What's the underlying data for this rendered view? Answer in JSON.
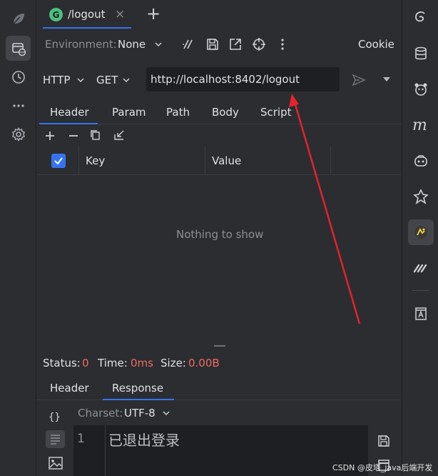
{
  "tab": {
    "badge": "G",
    "title": "/logout",
    "close": "×",
    "add": "+"
  },
  "toolbar": {
    "env_label": "Environment:",
    "env_value": "None",
    "cookie": "Cookie"
  },
  "request": {
    "protocol": "HTTP",
    "method": "GET",
    "url": "http://localhost:8402/logout"
  },
  "request_tabs": [
    "Header",
    "Param",
    "Path",
    "Body",
    "Script"
  ],
  "table": {
    "col_key": "Key",
    "col_value": "Value",
    "empty": "Nothing to show"
  },
  "status": {
    "status_label": "Status:",
    "status_value": "0",
    "time_label": "Time:",
    "time_value": "0ms",
    "size_label": "Size:",
    "size_value": "0.00B"
  },
  "response_tabs": [
    "Header",
    "Response"
  ],
  "response": {
    "charset_label": "Charset:",
    "charset_value": "UTF-8",
    "line_no": "1",
    "body": "已退出登录"
  },
  "watermark": "CSDN @皮塔_java后端开发",
  "colors": {
    "accent": "#3574f0",
    "error": "#ee6a62",
    "arrow": "#e5222d",
    "badge": "#4dbf7f"
  }
}
